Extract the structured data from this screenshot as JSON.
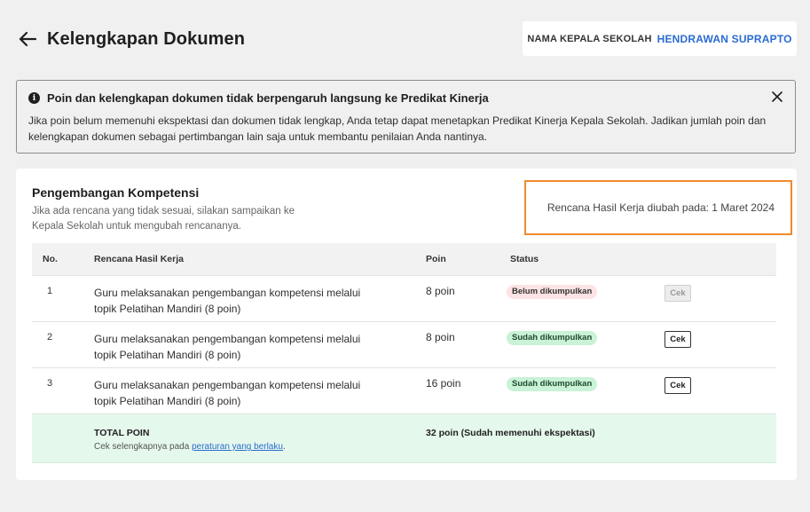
{
  "header": {
    "title": "Kelengkapan Dokumen",
    "principal_label": "NAMA KEPALA SEKOLAH",
    "principal_name": "HENDRAWAN SUPRAPTO"
  },
  "alert": {
    "icon": "info-icon",
    "title": "Poin dan kelengkapan dokumen tidak berpengaruh langsung ke Predikat Kinerja",
    "body": "Jika poin belum memenuhi ekspektasi dan dokumen tidak lengkap, Anda tetap dapat menetapkan Predikat Kinerja Kepala Sekolah. Jadikan jumlah poin dan kelengkapan dokumen sebagai pertimbangan lain saja untuk membantu penilaian Anda nantinya."
  },
  "section": {
    "title": "Pengembangan Kompetensi",
    "description": "Jika ada rencana yang tidak sesuai, silakan sampaikan ke Kepala Sekolah untuk mengubah rencananya.",
    "changed_text": "Rencana Hasil Kerja diubah pada: 1 Maret 2024"
  },
  "table": {
    "headers": [
      "No.",
      "Rencana Hasil Kerja",
      "Poin",
      "Status"
    ],
    "rows": [
      {
        "no": "1",
        "rhk": "Guru melaksanakan pengembangan kompetensi melalui topik Pelatihan Mandiri (8 poin)",
        "poin": "8 poin",
        "status": "Belum dikumpulkan",
        "status_color": "#fde3e3",
        "action": "Cek",
        "action_disabled": true
      },
      {
        "no": "2",
        "rhk": "Guru melaksanakan pengembangan kompetensi melalui topik Pelatihan Mandiri (8 poin)",
        "poin": "8 poin",
        "status": "Sudah dikumpulkan",
        "status_color": "#c9f2d6",
        "action": "Cek",
        "action_disabled": false
      },
      {
        "no": "3",
        "rhk": "Guru melaksanakan pengembangan kompetensi melalui topik Pelatihan Mandiri (8 poin)",
        "poin": "16 poin",
        "status": "Sudah dikumpulkan",
        "status_color": "#c9f2d6",
        "action": "Cek",
        "action_disabled": false
      }
    ],
    "total": {
      "label": "TOTAL POIN",
      "note_prefix": "Cek selengkapnya pada ",
      "note_link": "peraturan yang berlaku",
      "note_suffix": ".",
      "value": "32 poin (Sudah memenuhi ekspektasi)"
    }
  },
  "colors": {
    "accent_blue": "#2a6bd1",
    "highlight_orange": "#f28a2e",
    "total_row_bg": "#e5f8ec"
  }
}
